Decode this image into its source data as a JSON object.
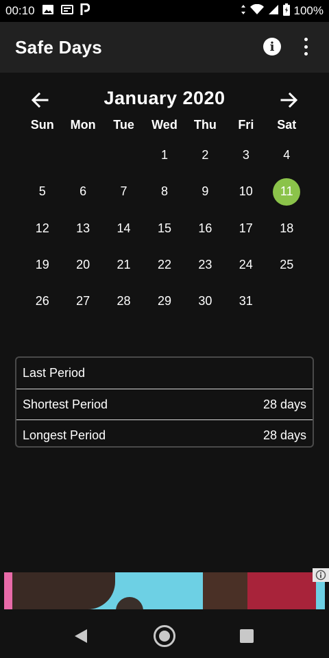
{
  "status_bar": {
    "time": "00:10",
    "battery": "100%",
    "icons": [
      "image-icon",
      "cast-icon",
      "parking-icon",
      "data-arrows-icon",
      "wifi-icon",
      "signal-icon",
      "battery-icon"
    ]
  },
  "app_bar": {
    "title": "Safe Days",
    "actions": [
      "info-icon",
      "more-vert-icon"
    ]
  },
  "calendar": {
    "month_label": "January 2020",
    "weekdays": [
      "Sun",
      "Mon",
      "Tue",
      "Wed",
      "Thu",
      "Fri",
      "Sat"
    ],
    "weeks": [
      [
        "",
        "",
        "",
        "1",
        "2",
        "3",
        "4"
      ],
      [
        "5",
        "6",
        "7",
        "8",
        "9",
        "10",
        "11"
      ],
      [
        "12",
        "13",
        "14",
        "15",
        "16",
        "17",
        "18"
      ],
      [
        "19",
        "20",
        "21",
        "22",
        "23",
        "24",
        "25"
      ],
      [
        "26",
        "27",
        "28",
        "29",
        "30",
        "31",
        ""
      ]
    ],
    "highlighted_day": "11",
    "highlight_color": "#8bc34a"
  },
  "stats": {
    "rows": [
      {
        "label": "Last Period",
        "value": ""
      },
      {
        "label": "Shortest Period",
        "value": "28 days"
      },
      {
        "label": "Longest Period",
        "value": "28 days"
      }
    ]
  },
  "colors": {
    "background": "#121212",
    "app_bar": "#212121",
    "accent": "#8bc34a"
  }
}
